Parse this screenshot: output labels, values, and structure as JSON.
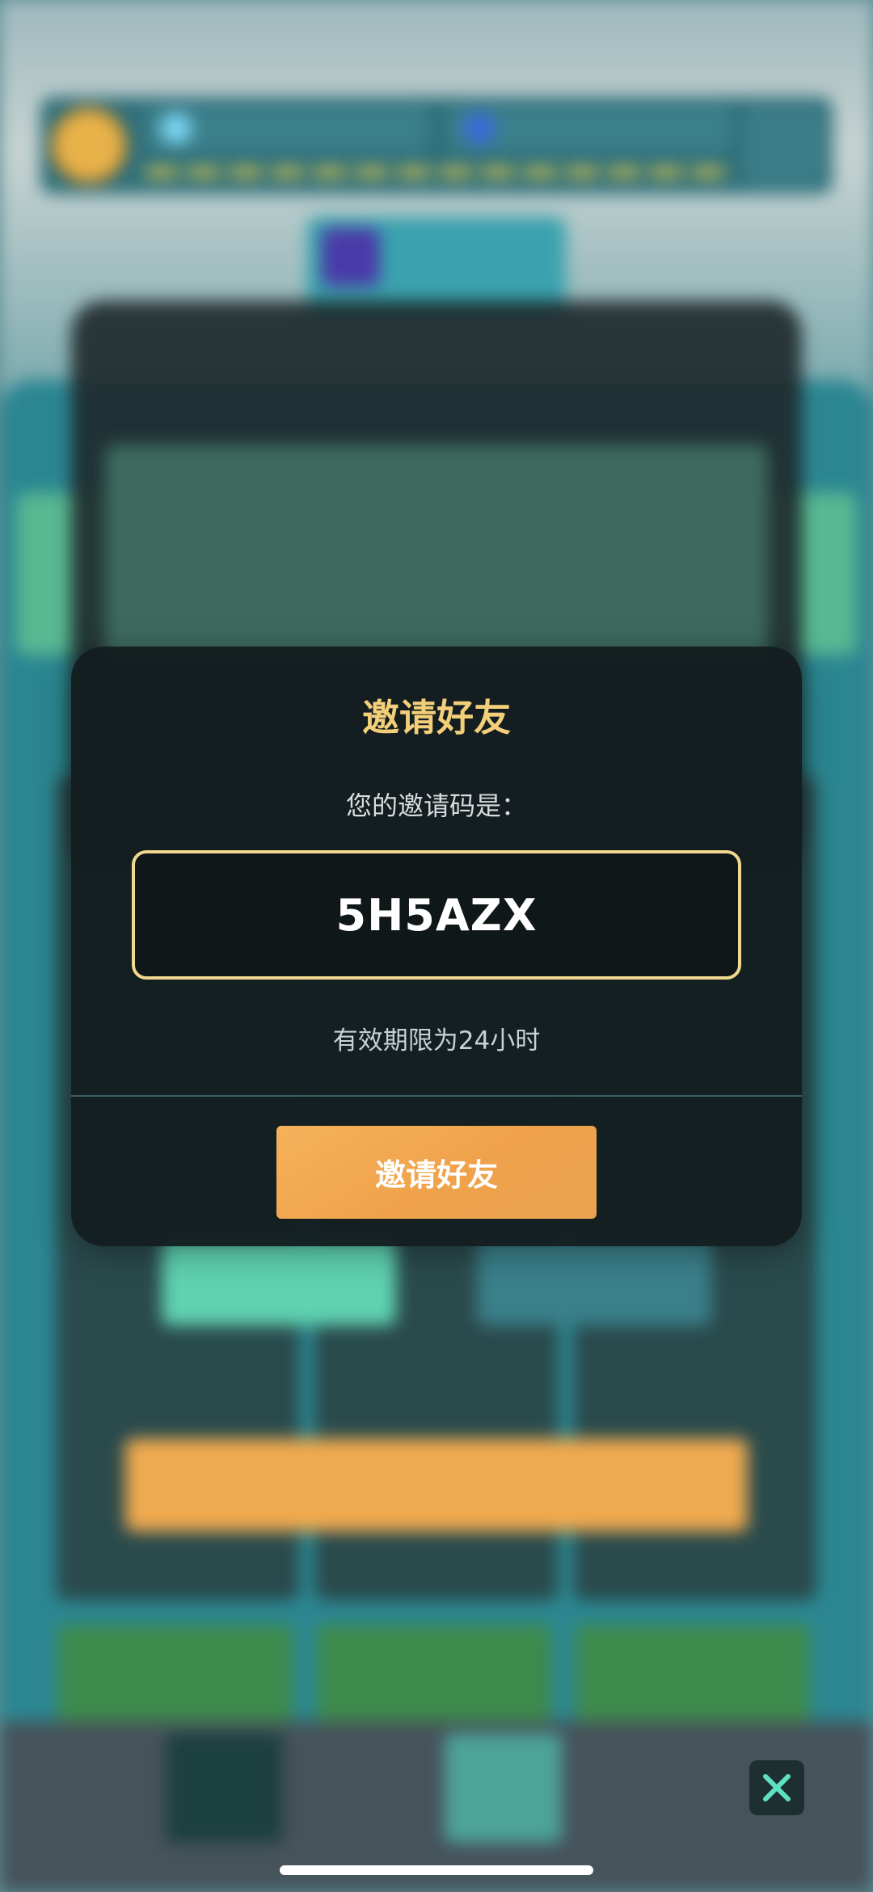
{
  "invite_dialog": {
    "title": "邀请好友",
    "subtitle": "您的邀请码是：",
    "invite_code": "5H5AZX",
    "validity": "有效期限为24小时",
    "invite_button_label": "邀请好友"
  },
  "colors": {
    "title_gold": "#f3cf7a",
    "code_border": "#f1d891",
    "button_orange": "#f0a24b",
    "close_icon": "#5fe0c0"
  },
  "icons": {
    "close": "close-x-icon"
  }
}
